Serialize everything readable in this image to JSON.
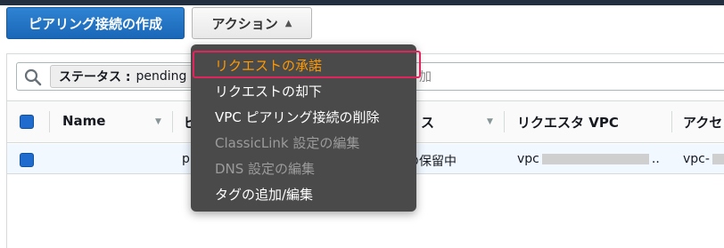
{
  "toolbar": {
    "create_label": "ピアリング接続の作成",
    "actions_label": "アクション",
    "actions_caret": "▲"
  },
  "search": {
    "filter_key": "ステータス :",
    "filter_value": "pending",
    "trailing_text": "加"
  },
  "table": {
    "columns": [
      {
        "label": "Name",
        "sortable": true
      },
      {
        "label": "ピ",
        "sortable": false
      },
      {
        "label": "ス",
        "sortable": true
      },
      {
        "label": "リクエスタ VPC",
        "sortable": false
      },
      {
        "label": "アクセ",
        "sortable": false
      }
    ],
    "row": {
      "name": "",
      "id_prefix": "p",
      "status": "の保留中",
      "requester_vpc_prefix": "vpc",
      "requester_vpc_suffix": "..",
      "accepter_vpc_prefix": "vpc-"
    }
  },
  "actions_menu": {
    "items": [
      {
        "label": "リクエストの承諾",
        "state": "highlighted",
        "color": "#ff9900"
      },
      {
        "label": "リクエストの却下",
        "state": "enabled"
      },
      {
        "label": "VPC ピアリング接続の削除",
        "state": "enabled"
      },
      {
        "label": "ClassicLink 設定の編集",
        "state": "disabled"
      },
      {
        "label": "DNS 設定の編集",
        "state": "disabled"
      },
      {
        "label": "タグの追加/編集",
        "state": "enabled"
      }
    ]
  },
  "colors": {
    "primary_button": "#1a67b8",
    "menu_background": "#4a4a4a",
    "highlight_border": "#e0245e",
    "highlight_text": "#ff9900",
    "selected_row": "#f1f8ff",
    "checkbox": "#1f6bce"
  },
  "icons": {
    "search": "search-icon",
    "sort": "sort-caret-icon",
    "caret": "caret-up-icon"
  }
}
